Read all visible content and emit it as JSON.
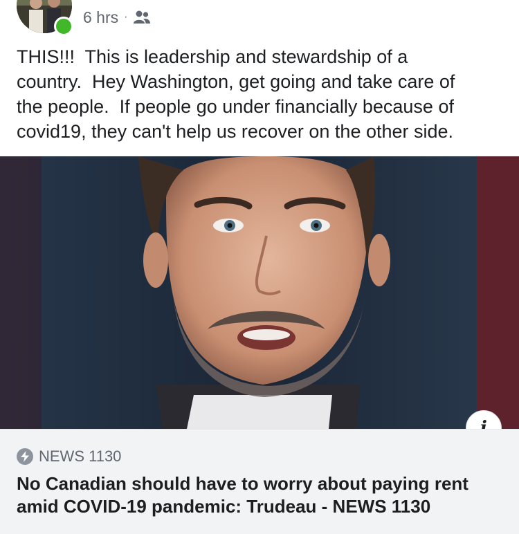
{
  "post": {
    "timestamp": "6 hrs",
    "separator": "·",
    "audience_icon": "friends-icon",
    "online_color": "#42b72a",
    "text": "THIS!!!  This is leadership and stewardship of a\ncountry.  Hey Washington, get going and take care of\nthe people.  If people go under financially because of\ncovid19, they can't help us recover on the other side."
  },
  "link": {
    "info_icon": "i",
    "source_icon": "bolt-icon",
    "source": "NEWS 1130",
    "headline": "No Canadian should have to worry about paying rent amid COVID-19 pandemic: Trudeau - NEWS 1130"
  }
}
